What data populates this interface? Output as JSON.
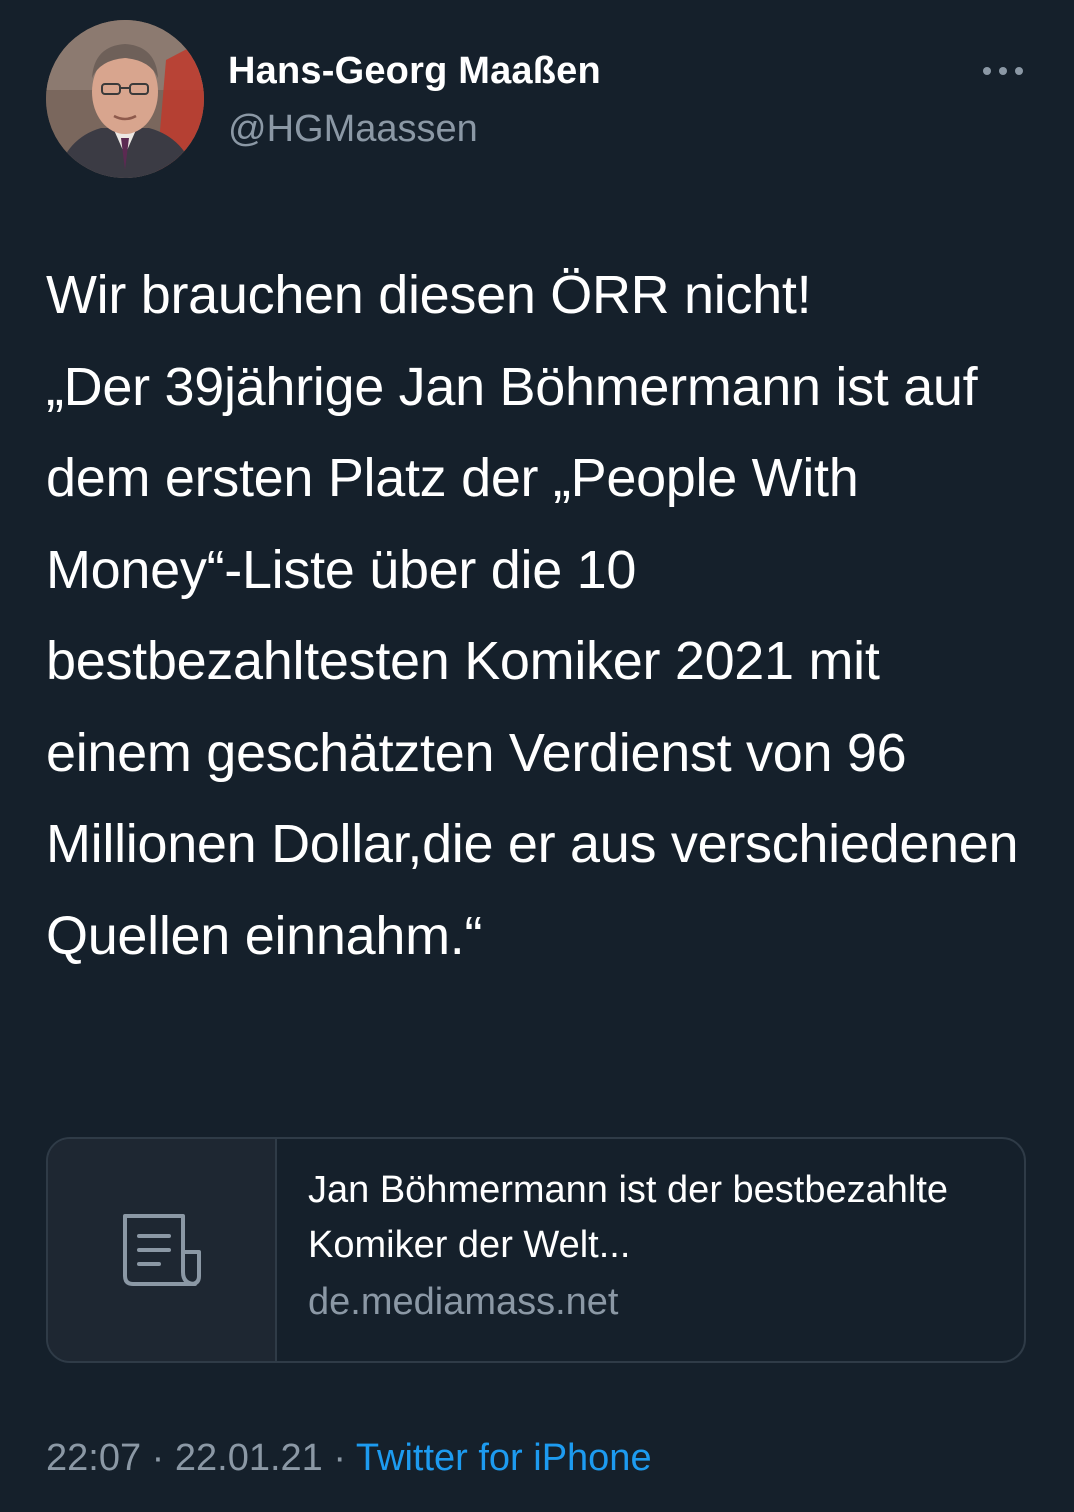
{
  "author": {
    "display_name": "Hans-Georg Maaßen",
    "handle": "@HGMaassen"
  },
  "tweet": {
    "text": "Wir brauchen diesen ÖRR nicht!\n„Der 39jährige Jan Böhmermann ist auf dem ersten Platz der „People With Money“-Liste über die 10 bestbezahltesten Komiker 2021 mit einem geschätzten Verdienst von 96 Millionen Dollar,die er aus verschiedenen Quellen einnahm.“"
  },
  "link_card": {
    "icon": "document-icon",
    "title": "Jan Böhmermann ist der bestbezahlte Komiker der Welt...",
    "domain": "de.mediamass.net"
  },
  "meta": {
    "time": "22:07",
    "separator": "·",
    "date": "22.01.21",
    "source": "Twitter for iPhone"
  },
  "colors": {
    "background": "#15202b",
    "secondary_text": "#8b98a5",
    "link": "#1d9bf0",
    "border": "#2f3b47"
  }
}
